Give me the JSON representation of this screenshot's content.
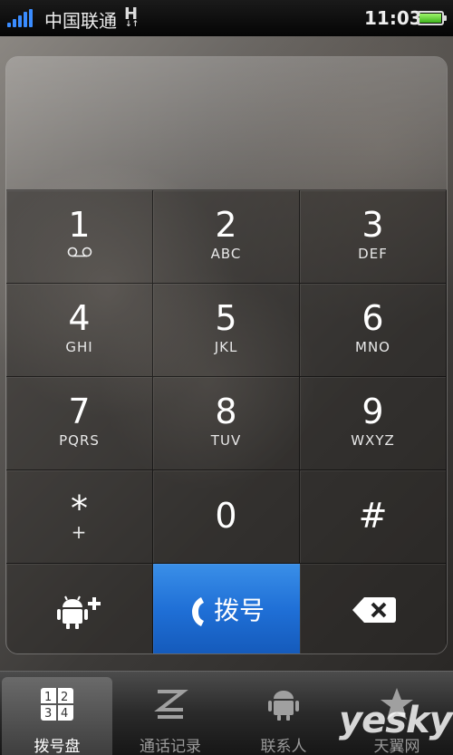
{
  "status": {
    "carrier": "中国联通",
    "network": "H",
    "time": "11:03"
  },
  "display": {
    "number": ""
  },
  "keypad": [
    {
      "digit": "1",
      "letters": "",
      "icon": "voicemail-icon"
    },
    {
      "digit": "2",
      "letters": "ABC"
    },
    {
      "digit": "3",
      "letters": "DEF"
    },
    {
      "digit": "4",
      "letters": "GHI"
    },
    {
      "digit": "5",
      "letters": "JKL"
    },
    {
      "digit": "6",
      "letters": "MNO"
    },
    {
      "digit": "7",
      "letters": "PQRS"
    },
    {
      "digit": "8",
      "letters": "TUV"
    },
    {
      "digit": "9",
      "letters": "WXYZ"
    },
    {
      "digit": "*",
      "letters": "+"
    },
    {
      "digit": "0",
      "letters": ""
    },
    {
      "digit": "#",
      "letters": ""
    }
  ],
  "actions": {
    "add_contact_icon": "add-contact-icon",
    "call_label": "拨号",
    "backspace_icon": "backspace-icon"
  },
  "tabs": [
    {
      "label": "拨号盘",
      "icon": "dialpad-icon",
      "active": true
    },
    {
      "label": "通话记录",
      "icon": "call-log-icon",
      "active": false
    },
    {
      "label": "联系人",
      "icon": "contacts-icon",
      "active": false
    },
    {
      "label": "天翼网",
      "icon": "star-icon",
      "active": false
    }
  ],
  "watermark": "yesky",
  "colors": {
    "call_button": "#1f6fd6",
    "signal": "#3a8cff",
    "battery": "#3fb41d"
  }
}
